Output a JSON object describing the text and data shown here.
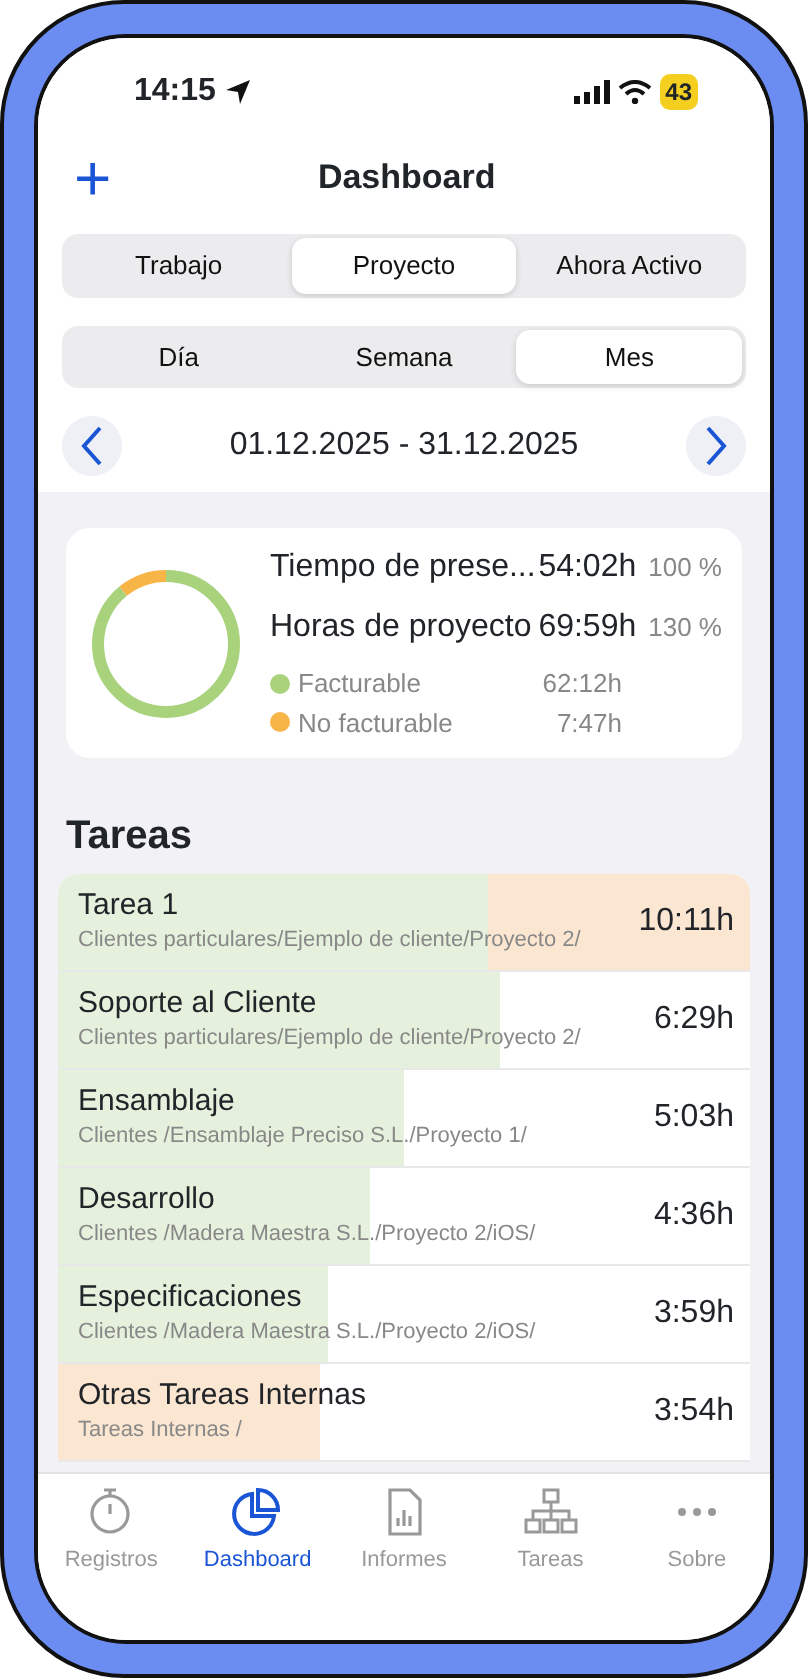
{
  "status_bar": {
    "time": "14:15",
    "battery": "43"
  },
  "nav": {
    "title": "Dashboard",
    "add_symbol": "+"
  },
  "view_tabs": [
    {
      "label": "Trabajo",
      "selected": false
    },
    {
      "label": "Proyecto",
      "selected": true
    },
    {
      "label": "Ahora Activo",
      "selected": false
    }
  ],
  "period_tabs": [
    {
      "label": "Día",
      "selected": false
    },
    {
      "label": "Semana",
      "selected": false
    },
    {
      "label": "Mes",
      "selected": true
    }
  ],
  "date_range": "01.12.2025 - 31.12.2025",
  "summary": {
    "donut": [
      {
        "color": "#a8d37c",
        "level": 0.89
      },
      {
        "color": "#f7b548",
        "level": 0.11
      }
    ],
    "rows": [
      {
        "label": "Tiempo de prese...",
        "value": "54:02h",
        "percent": "100 %"
      },
      {
        "label": "Horas de proyecto",
        "value": "69:59h",
        "percent": "130 %"
      }
    ],
    "legend": [
      {
        "label": "Facturable",
        "value": "62:12h",
        "color": "#a8d37c"
      },
      {
        "label": "No facturable",
        "value": "7:47h",
        "color": "#f7b548"
      }
    ]
  },
  "tasks_heading": "Tareas",
  "tasks": [
    {
      "name": "Tarea 1",
      "path": "Clientes particulares/Ejemplo de cliente/Proyecto 2/",
      "time": "10:11h",
      "bars": [
        {
          "color": "#e6f1dd",
          "level": 0.62
        },
        {
          "color": "#fbe6d1",
          "level": 0.38
        }
      ]
    },
    {
      "name": "Soporte al Cliente",
      "path": "Clientes particulares/Ejemplo de cliente/Proyecto 2/",
      "time": "6:29h",
      "bars": [
        {
          "color": "#e6f1dd",
          "level": 0.64
        }
      ]
    },
    {
      "name": "Ensamblaje",
      "path": "Clientes /Ensamblaje Preciso S.L./Proyecto 1/",
      "time": "5:03h",
      "bars": [
        {
          "color": "#e6f1dd",
          "level": 0.5
        }
      ]
    },
    {
      "name": "Desarrollo",
      "path": "Clientes /Madera Maestra S.L./Proyecto 2/iOS/",
      "time": "4:36h",
      "bars": [
        {
          "color": "#e6f1dd",
          "level": 0.45
        }
      ]
    },
    {
      "name": "Especificaciones",
      "path": "Clientes /Madera Maestra S.L./Proyecto 2/iOS/",
      "time": "3:59h",
      "bars": [
        {
          "color": "#e6f1dd",
          "level": 0.39
        }
      ]
    },
    {
      "name": "Otras Tareas Internas",
      "path": "Tareas Internas  /",
      "time": "3:54h",
      "bars": [
        {
          "color": "#fbe6d1",
          "level": 0.38
        }
      ]
    }
  ],
  "tab_bar": [
    {
      "kind": "timer",
      "label": "Registros",
      "selected": false
    },
    {
      "kind": "chart",
      "label": "Dashboard",
      "selected": true
    },
    {
      "kind": "report",
      "label": "Informes",
      "selected": false
    },
    {
      "kind": "tree",
      "label": "Tareas",
      "selected": false
    },
    {
      "kind": "more",
      "label": "Sobre",
      "selected": false
    }
  ]
}
